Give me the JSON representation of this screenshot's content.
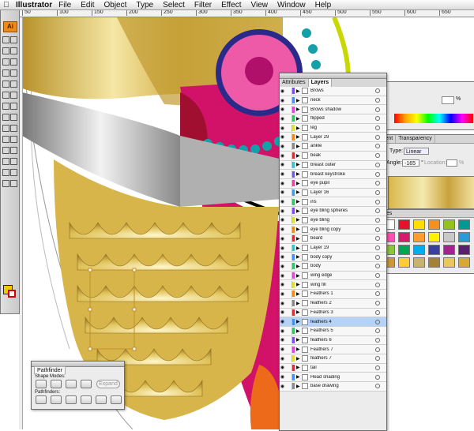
{
  "menubar": {
    "app_name": "Illustrator",
    "items": [
      "File",
      "Edit",
      "Object",
      "Type",
      "Select",
      "Filter",
      "Effect",
      "View",
      "Window",
      "Help"
    ]
  },
  "ruler": {
    "labels": [
      "50",
      "100",
      "150",
      "200",
      "250",
      "300",
      "350",
      "400",
      "450",
      "500",
      "550",
      "600",
      "650"
    ]
  },
  "tools": {
    "logo": "Ai"
  },
  "layers_panel": {
    "tabs": [
      "Attributes",
      "Layers"
    ],
    "active_tab": "Layers",
    "layers": [
      {
        "name": "Brows",
        "color": "#7b4df2"
      },
      {
        "name": "neck",
        "color": "#4c8df2"
      },
      {
        "name": "Brows shadow",
        "color": "#e04ad8"
      },
      {
        "name": "flipped",
        "color": "#3ac26b"
      },
      {
        "name": "leg",
        "color": "#e3df3a"
      },
      {
        "name": "Layer 29",
        "color": "#ee8a20"
      },
      {
        "name": "ankle",
        "color": "#8a8a8a"
      },
      {
        "name": "beak",
        "color": "#d8303a"
      },
      {
        "name": "breast outer",
        "color": "#40c0c8"
      },
      {
        "name": "breast keystroke",
        "color": "#6a5de0"
      },
      {
        "name": "eye pupil",
        "color": "#e04a9a"
      },
      {
        "name": "Layer 16",
        "color": "#4a9ae0"
      },
      {
        "name": "iris",
        "color": "#3ac26b"
      },
      {
        "name": "eye bling spheres",
        "color": "#7b4df2"
      },
      {
        "name": "eye bling",
        "color": "#e3df3a"
      },
      {
        "name": "eye bling copy",
        "color": "#ee8a20"
      },
      {
        "name": "beard",
        "color": "#d8303a"
      },
      {
        "name": "Layer 19",
        "color": "#40c0c8"
      },
      {
        "name": "body copy",
        "color": "#4c8df2"
      },
      {
        "name": "body",
        "color": "#3ac26b"
      },
      {
        "name": "wing edge",
        "color": "#e04ad8"
      },
      {
        "name": "wing fill",
        "color": "#e3df3a"
      },
      {
        "name": "Feathers 1",
        "color": "#ee8a20"
      },
      {
        "name": "feathers 2",
        "color": "#8a8a8a"
      },
      {
        "name": "Feathers 3",
        "color": "#d8303a"
      },
      {
        "name": "feathers 4",
        "color": "#4c8df2",
        "selected": true
      },
      {
        "name": "Feathers 5",
        "color": "#3ac26b"
      },
      {
        "name": "feathers 6",
        "color": "#7b4df2"
      },
      {
        "name": "Feathers 7",
        "color": "#e04ad8"
      },
      {
        "name": "feathers 7",
        "color": "#e3df3a"
      },
      {
        "name": "tail",
        "color": "#d8303a"
      },
      {
        "name": "Head shading",
        "color": "#4c8df2"
      },
      {
        "name": "base drawing",
        "color": "#8a8a8a"
      }
    ]
  },
  "gradient_panel": {
    "tabs": [
      "dient",
      "Transparency"
    ],
    "type_label": "Type:",
    "type_value": "Linear",
    "angle_label": "Angle:",
    "angle_value": "-165",
    "angle_unit": "°",
    "location_label": "Location:",
    "location_unit": "%"
  },
  "color_panel": {
    "unit": "%"
  },
  "swatches_panel": {
    "header": "hes",
    "colors": [
      "#ffffff",
      "#e8112d",
      "#ffde00",
      "#f78f1e",
      "#95c11f",
      "#009a93",
      "#ff4fb0",
      "#d71a6b",
      "#ff9d2e",
      "#fff200",
      "#c8c8c8",
      "#2a9ad8",
      "#8cc63f",
      "#00a651",
      "#00aeef",
      "#3b3fa0",
      "#a3228e",
      "#5b1f6e",
      "#c89a3c",
      "#ffcc33",
      "#c7b26e",
      "#a38233",
      "#e8c85a",
      "#d8a830"
    ]
  },
  "pathfinder_panel": {
    "tab": "Pathfinder",
    "shape_modes_label": "Shape Modes:",
    "pathfinders_label": "Pathfinders:",
    "expand_label": "Expand"
  }
}
